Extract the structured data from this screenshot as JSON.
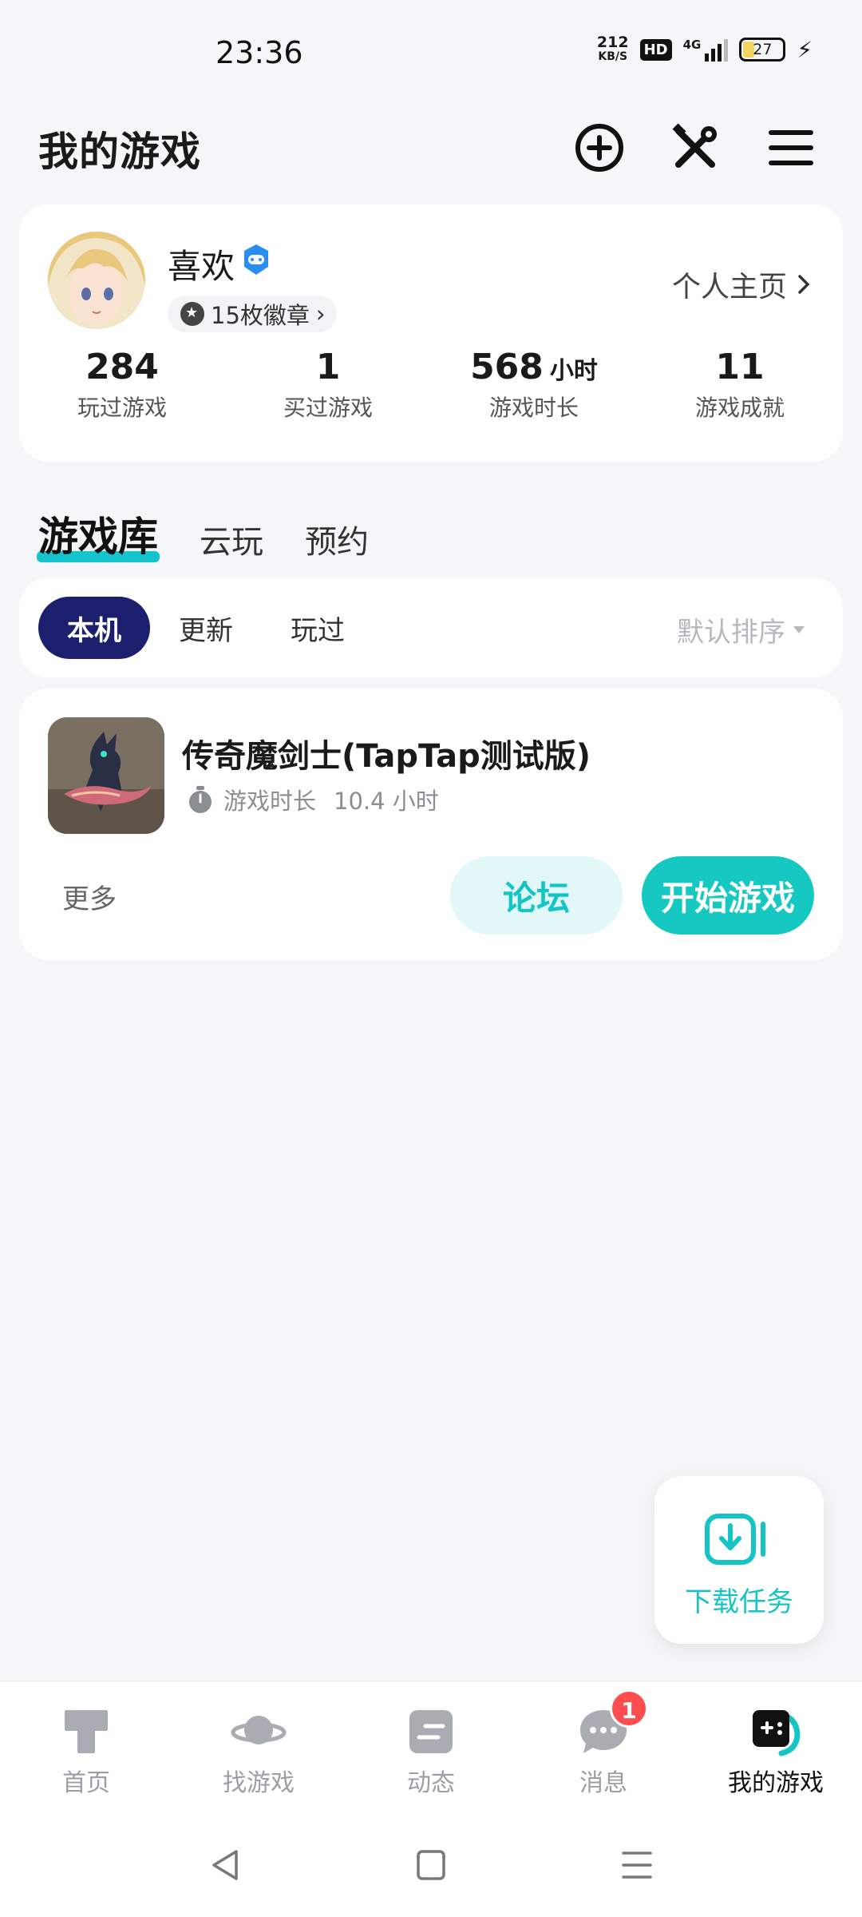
{
  "status_bar": {
    "time": "23:36",
    "net_speed_value": "212",
    "net_speed_unit": "KB/S",
    "hd": "HD",
    "network": "4G",
    "battery": "27",
    "icons": [
      "signal-icon",
      "battery-icon",
      "charging-icon"
    ]
  },
  "header": {
    "title": "我的游戏",
    "icons": [
      "add-circle-icon",
      "tools-icon",
      "menu-icon"
    ]
  },
  "profile": {
    "username": "喜欢",
    "badges": "15枚徽章",
    "homepage_link": "个人主页",
    "stats": [
      {
        "value": "284",
        "unit": "",
        "label": "玩过游戏"
      },
      {
        "value": "1",
        "unit": "",
        "label": "买过游戏"
      },
      {
        "value": "568",
        "unit": "小时",
        "label": "游戏时长"
      },
      {
        "value": "11",
        "unit": "",
        "label": "游戏成就"
      }
    ]
  },
  "tabs": [
    "游戏库",
    "云玩",
    "预约"
  ],
  "filters": {
    "items": [
      "本机",
      "更新",
      "玩过"
    ],
    "active": "本机",
    "sort": "默认排序"
  },
  "game": {
    "name": "传奇魔剑士(TapTap测试版)",
    "time_label": "游戏时长",
    "time_value": "10.4 小时",
    "more": "更多",
    "forum_button": "论坛",
    "start_button": "开始游戏"
  },
  "floating": {
    "label": "下载任务"
  },
  "bottom_nav": {
    "items": [
      {
        "label": "首页",
        "icon": "home-icon"
      },
      {
        "label": "找游戏",
        "icon": "planet-icon"
      },
      {
        "label": "动态",
        "icon": "feed-icon"
      },
      {
        "label": "消息",
        "icon": "chat-icon",
        "badge": "1"
      },
      {
        "label": "我的游戏",
        "icon": "gamepad-icon"
      }
    ],
    "active": "我的游戏"
  },
  "colors": {
    "accent": "#15c5c5",
    "filter_active": "#1b1f6e",
    "badge_red": "#ff4d4f",
    "background": "#f4f6f8"
  }
}
